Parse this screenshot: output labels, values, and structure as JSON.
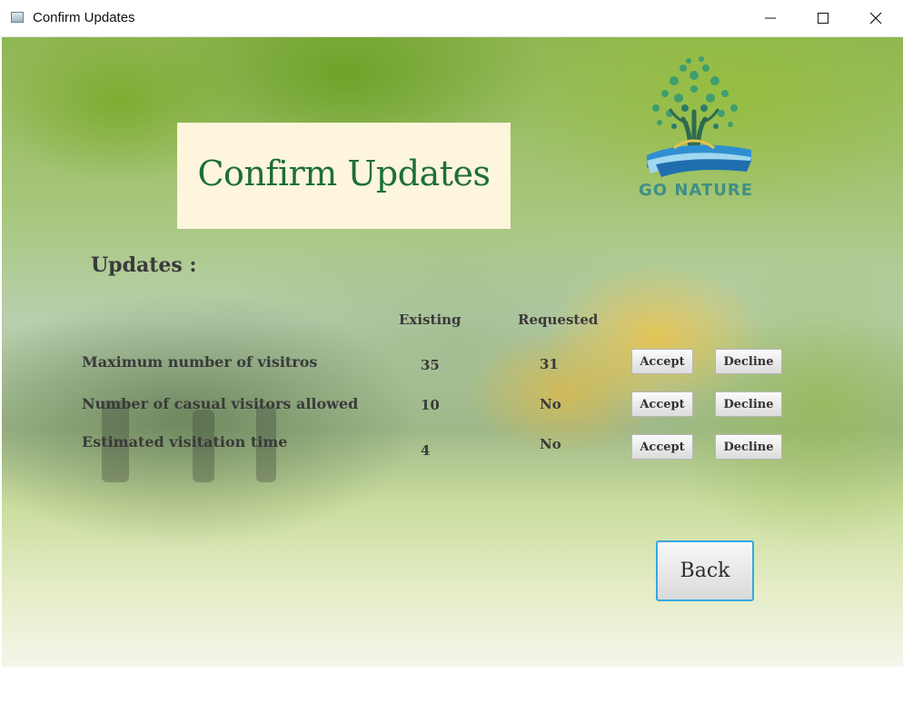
{
  "window": {
    "title": "Confirm Updates",
    "controls": [
      "minimize-icon",
      "maximize-icon",
      "close-icon"
    ]
  },
  "header": {
    "title": "Confirm Updates",
    "logo_text": "GO NATURE"
  },
  "section": {
    "label": "Updates :"
  },
  "table": {
    "columns": {
      "existing": "Existing",
      "requested": "Requested"
    },
    "rows": [
      {
        "label": "Maximum number of visitros",
        "existing": "35",
        "requested": "31",
        "accept": "Accept",
        "decline": "Decline"
      },
      {
        "label": "Number of casual visitors allowed",
        "existing": "10",
        "requested": "No",
        "accept": "Accept",
        "decline": "Decline"
      },
      {
        "label": "Estimated visitation time",
        "existing": "4",
        "requested": "No",
        "accept": "Accept",
        "decline": "Decline"
      }
    ]
  },
  "footer": {
    "back_label": "Back"
  },
  "colors": {
    "title_text": "#1d6e3c",
    "title_card_bg": "#fdf5dc",
    "back_border": "#36a7e2",
    "logo_teal": "#3f8f86"
  }
}
